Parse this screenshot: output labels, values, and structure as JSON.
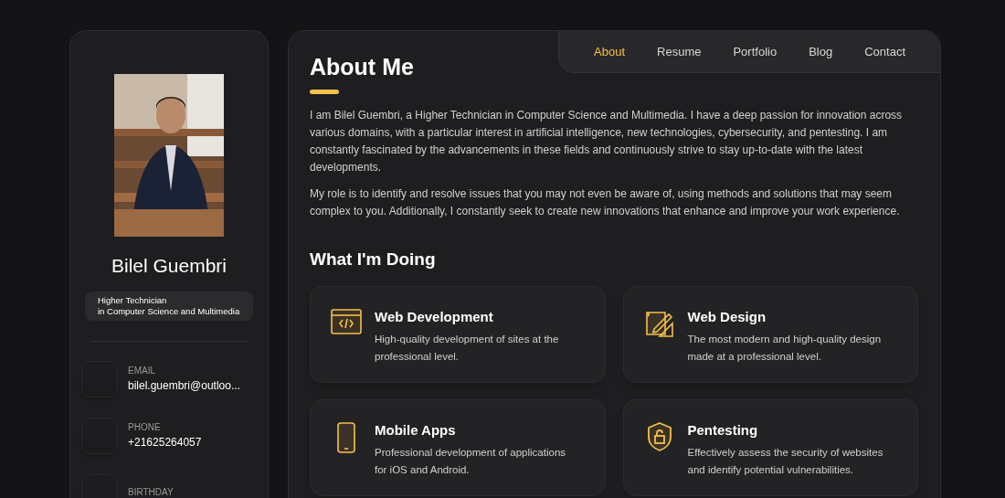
{
  "sidebar": {
    "name": "Bilel Guembri",
    "title_lines": [
      "Higher Technician",
      "in Computer Science and Multimedia"
    ],
    "contacts": [
      {
        "label": "EMAIL",
        "value": "bilel.guembri@outloo..."
      },
      {
        "label": "PHONE",
        "value": "+21625264057"
      },
      {
        "label": "BIRTHDAY"
      }
    ]
  },
  "nav": [
    {
      "label": "About",
      "selected": true
    },
    {
      "label": "Resume",
      "selected": false
    },
    {
      "label": "Portfolio",
      "selected": false
    },
    {
      "label": "Blog",
      "selected": false
    },
    {
      "label": "Contact",
      "selected": false
    }
  ],
  "heading": "About Me",
  "paragraphs": [
    "I am Bilel Guembri, a Higher Technician in Computer Science and Multimedia. I have a deep passion for innovation across various domains, with a particular interest in artificial intelligence, new technologies, cybersecurity, and pentesting. I am constantly fascinated by the advancements in these fields and continuously strive to stay up-to-date with the latest developments.",
    "My role is to identify and resolve issues that you may not even be aware of, using methods and solutions that may seem complex to you. Additionally, I constantly seek to create new innovations that enhance and improve your work experience."
  ],
  "services_heading": "What I'm Doing",
  "services": [
    {
      "kind": "code",
      "title": "Web Development",
      "text": "High-quality development of sites at the professional level."
    },
    {
      "kind": "design",
      "title": "Web Design",
      "text": "The most modern and high-quality design made at a professional level."
    },
    {
      "kind": "mobile",
      "title": "Mobile Apps",
      "text": "Professional development of applications for iOS and Android."
    },
    {
      "kind": "shield",
      "title": "Pentesting",
      "text": "Effectively assess the security of websites and identify potential vulnerabilities."
    }
  ]
}
